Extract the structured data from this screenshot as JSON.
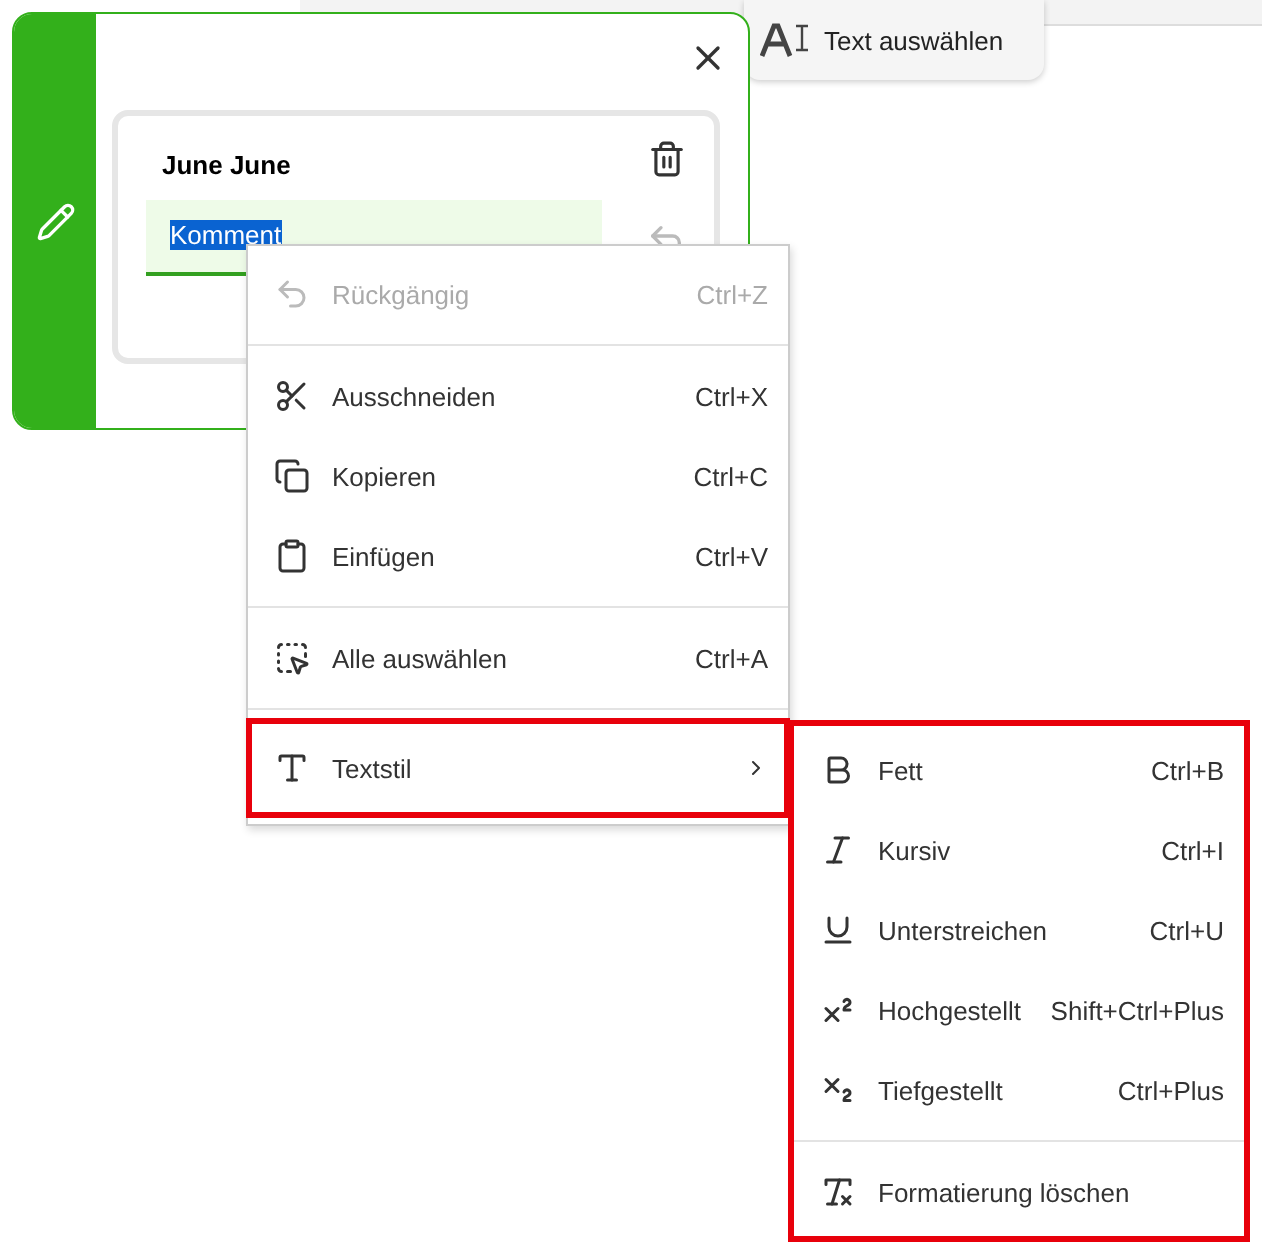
{
  "tooltip": {
    "label": "Text auswählen"
  },
  "comment": {
    "author": "June June",
    "text": "Komment",
    "text_selected": true
  },
  "context_menu": {
    "items": [
      {
        "kind": "item",
        "label": "Rückgängig",
        "shortcut": "Ctrl+Z",
        "disabled": true,
        "highlighted": false
      },
      {
        "kind": "separator"
      },
      {
        "kind": "item",
        "label": "Ausschneiden",
        "shortcut": "Ctrl+X",
        "disabled": false,
        "highlighted": false
      },
      {
        "kind": "item",
        "label": "Kopieren",
        "shortcut": "Ctrl+C",
        "disabled": false,
        "highlighted": false
      },
      {
        "kind": "item",
        "label": "Einfügen",
        "shortcut": "Ctrl+V",
        "disabled": false,
        "highlighted": false
      },
      {
        "kind": "separator"
      },
      {
        "kind": "item",
        "label": "Alle auswählen",
        "shortcut": "Ctrl+A",
        "disabled": false,
        "highlighted": false
      },
      {
        "kind": "separator"
      },
      {
        "kind": "submenu",
        "label": "Textstil",
        "disabled": false,
        "highlighted": true
      }
    ]
  },
  "submenu": {
    "highlighted": true,
    "items": [
      {
        "kind": "item",
        "label": "Fett",
        "shortcut": "Ctrl+B"
      },
      {
        "kind": "item",
        "label": "Kursiv",
        "shortcut": "Ctrl+I"
      },
      {
        "kind": "item",
        "label": "Unterstreichen",
        "shortcut": "Ctrl+U"
      },
      {
        "kind": "item",
        "label": "Hochgestellt",
        "shortcut": "Shift+Ctrl+Plus"
      },
      {
        "kind": "item",
        "label": "Tiefgestellt",
        "shortcut": "Ctrl+Plus"
      },
      {
        "kind": "separator"
      },
      {
        "kind": "item",
        "label": "Formatierung löschen"
      }
    ]
  }
}
